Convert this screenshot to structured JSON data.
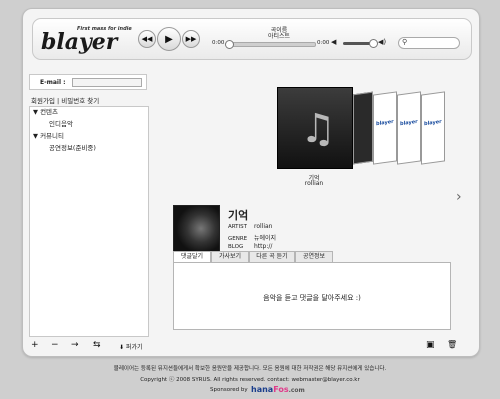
{
  "header": {
    "logo": "blayer",
    "tagline": "First mass for indie",
    "controls": {
      "prev_icon": "◀◀",
      "play_icon": "▶",
      "next_icon": "▶▶"
    },
    "now_playing": {
      "title": "곡이름",
      "artist": "아티스트"
    },
    "time_elapsed": "0:00",
    "time_total": "0:00",
    "progress": 0,
    "volume": 0.9,
    "mute_icon": "◀",
    "volume_icon": "◀)",
    "search": {
      "icon": "search-icon",
      "placeholder": ""
    }
  },
  "sidebar": {
    "email_label": "E-mail :",
    "signup_label": "회원가입 | ",
    "find_password_label": "비밀번호 찾기",
    "tree": [
      {
        "label": "▼ 컨텐츠",
        "children": [
          "인디음악"
        ]
      },
      {
        "label": "▼ 커뮤니티",
        "children": [
          "공연정보(준비중)"
        ]
      }
    ]
  },
  "toolbar": {
    "add": "+",
    "remove": "−",
    "repeat": "→",
    "shuffle": "⇆",
    "share_label": "⬇ 퍼가기",
    "save_icon": "▣",
    "trash_icon": "🗑"
  },
  "coverflow": {
    "current_title": "기억",
    "current_artist": "rollian",
    "side_logo": "blayer"
  },
  "track": {
    "title": "기억",
    "artist_key": "ARTIST",
    "artist": "rollian",
    "genre_key": "GENRE",
    "genre": "뉴에이지",
    "blog_key": "BLOG",
    "blog": "http://"
  },
  "tabs": [
    "댓글달기",
    "가사보기",
    "다른 곡 듣기",
    "공연정보"
  ],
  "comment_prompt": "음악을 듣고 댓글을 달아주세요 :)",
  "footer": {
    "line1": "블레이어는 등록된 뮤지션들에게서 확보한 음원만을 제공합니다. 모든 음원에 대한 저작권은 해당 뮤지션에게 있습니다.",
    "line2": "Copyright ⓒ 2008 SYRUS. All rights reserved.   contact: webmaster@blayer.co.kr",
    "sponsor_label": "Sponsored by",
    "sponsor_name_a": "hana",
    "sponsor_name_b": "Fos",
    "sponsor_name_c": ".com"
  }
}
